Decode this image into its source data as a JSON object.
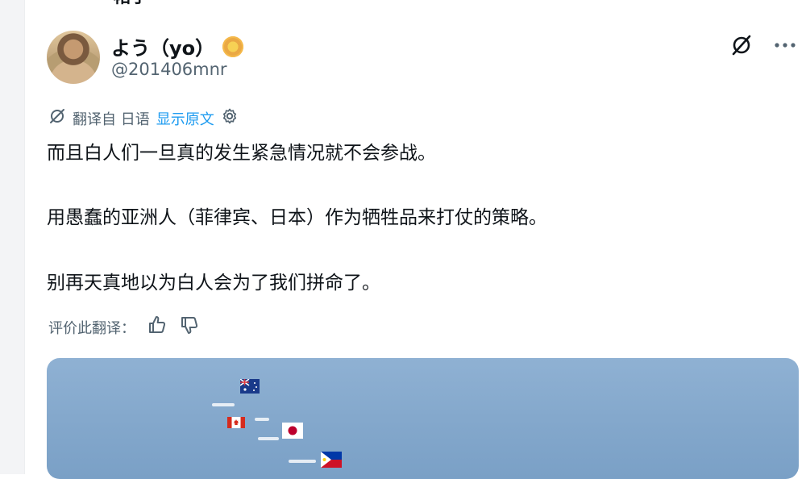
{
  "header": {
    "back_glyph": "←",
    "title_partial": "帖子"
  },
  "author": {
    "display_name": "よう（yo）",
    "handle": "@201406mnr",
    "badge": "gold-badge-icon"
  },
  "translation": {
    "label": "翻译自 日语",
    "show_original": "显示原文"
  },
  "post": {
    "line1": "而且白人们一旦真的发生紧急情况就不会参战。",
    "line2": "用愚蠢的亚洲人（菲律宾、日本）作为牺牲品来打仗的策略。",
    "line3": "别再天真地以为白人会为了我们拼命了。"
  },
  "rating": {
    "label": "评价此翻译："
  },
  "colors": {
    "text": "#0f1419",
    "muted": "#536471",
    "link": "#1d9bf0",
    "sea": "#84a8cc"
  }
}
